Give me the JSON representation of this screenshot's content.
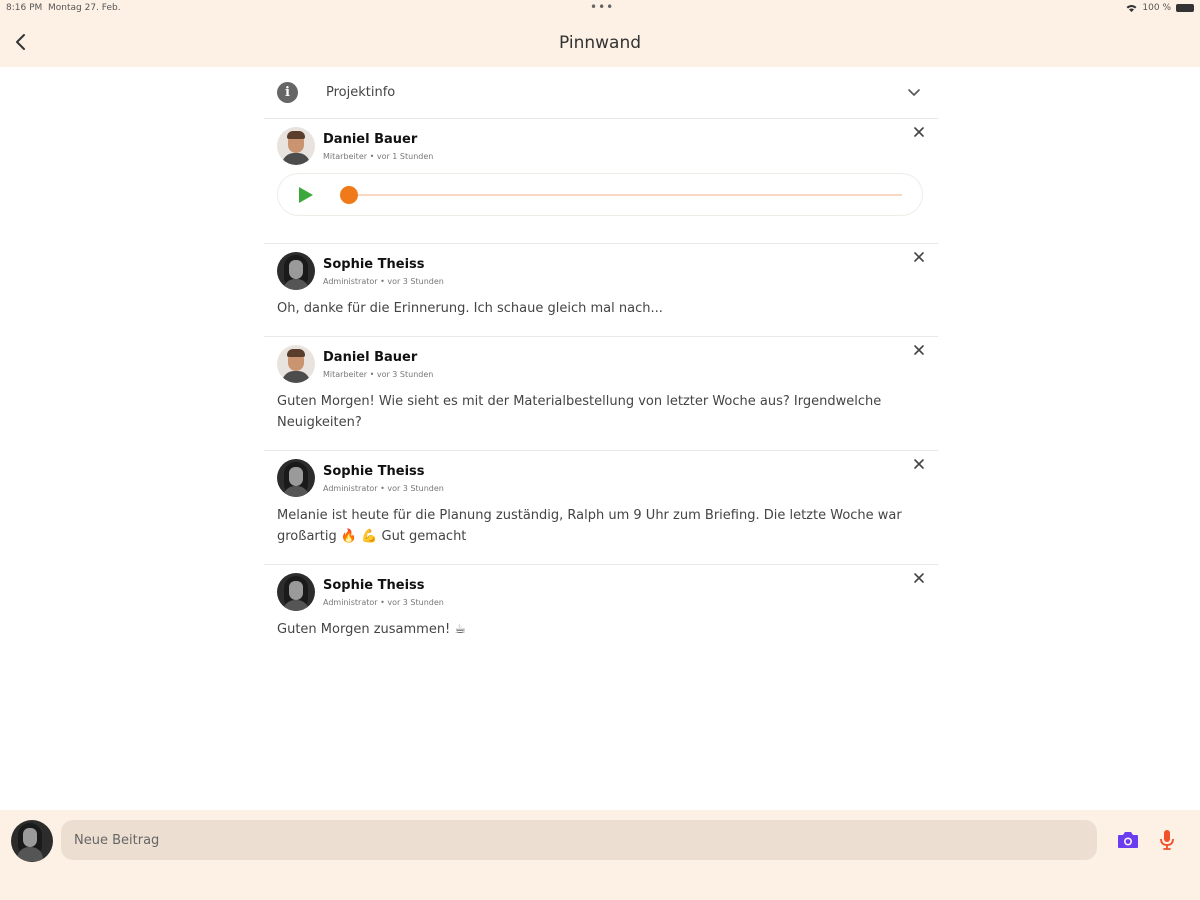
{
  "status_bar": {
    "time": "8:16 PM",
    "date": "Montag 27. Feb.",
    "dots": "•••",
    "battery": "100 %"
  },
  "header": {
    "title": "Pinnwand"
  },
  "project_info": {
    "label": "Projektinfo"
  },
  "posts": [
    {
      "author": "Daniel Bauer",
      "meta": "Mitarbeiter • vor 1 Stunden",
      "type": "audio",
      "audio_progress": 0.0
    },
    {
      "author": "Sophie Theiss",
      "meta": "Administrator • vor 3 Stunden",
      "text": "Oh, danke für die Erinnerung. Ich schaue gleich mal nach..."
    },
    {
      "author": "Daniel Bauer",
      "meta": "Mitarbeiter • vor 3 Stunden",
      "text": "Guten Morgen! Wie sieht es mit der Materialbestellung von letzter Woche aus? Irgendwelche Neuigkeiten?"
    },
    {
      "author": "Sophie Theiss",
      "meta": "Administrator • vor 3 Stunden",
      "text": "Melanie ist heute für die Planung zuständig, Ralph um 9 Uhr zum Briefing. Die letzte Woche war großartig 🔥 💪  Gut gemacht"
    },
    {
      "author": "Sophie Theiss",
      "meta": "Administrator • vor 3 Stunden",
      "text": "Guten Morgen zusammen! ☕"
    }
  ],
  "composer": {
    "placeholder": "Neue Beitrag"
  },
  "colors": {
    "header_bg": "#fdf1e5",
    "accent_orange": "#f07a1a",
    "play_green": "#3aa83a",
    "camera_purple": "#6a3df0",
    "mic_red": "#f0502a"
  }
}
